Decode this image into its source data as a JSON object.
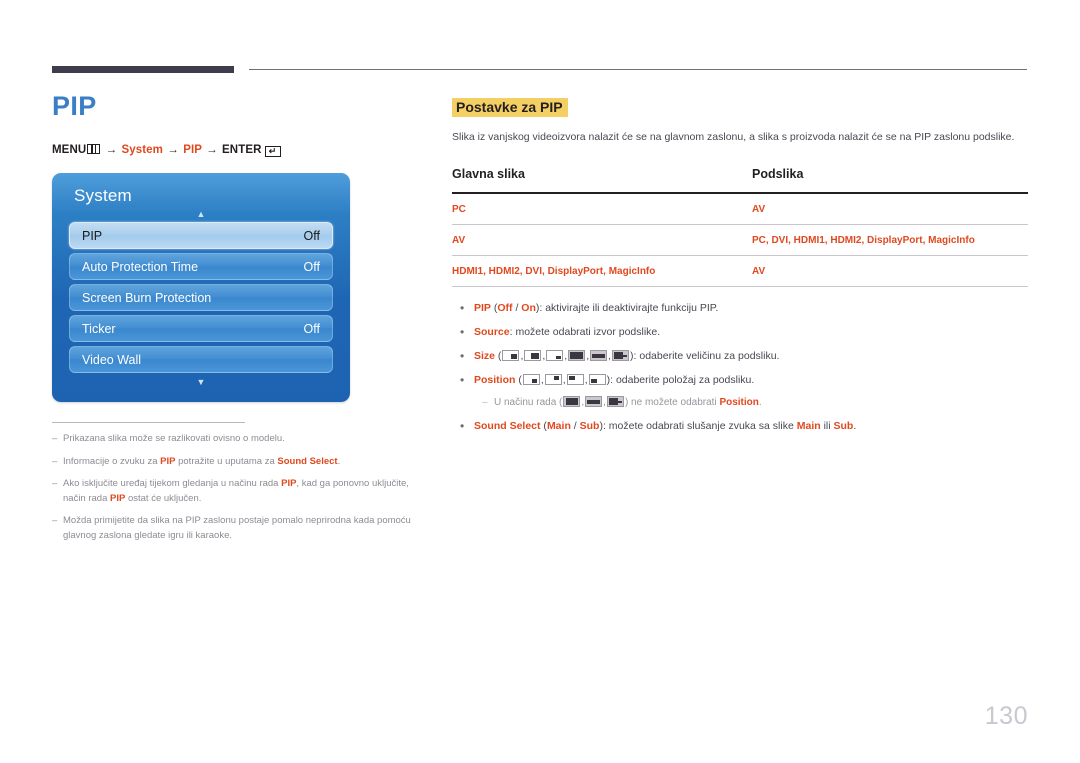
{
  "page": {
    "number": "130"
  },
  "left": {
    "title": "PIP",
    "menu_path": {
      "prefix": "MENU",
      "menu_icon": "menu-grid-icon",
      "arrow": "→",
      "step1": "System",
      "step2": "PIP",
      "enter_label": "ENTER",
      "enter_icon": "enter-key-icon",
      "enter_glyph": "↵"
    },
    "osd": {
      "title": "System",
      "scroll_up_icon": "▲",
      "scroll_down_icon": "▼",
      "rows": [
        {
          "label": "PIP",
          "value": "Off",
          "selected": true
        },
        {
          "label": "Auto Protection Time",
          "value": "Off",
          "selected": false
        },
        {
          "label": "Screen Burn Protection",
          "value": "",
          "selected": false
        },
        {
          "label": "Ticker",
          "value": "Off",
          "selected": false
        },
        {
          "label": "Video Wall",
          "value": "",
          "selected": false
        }
      ]
    },
    "footnotes": [
      {
        "dash": "–",
        "parts": [
          {
            "t": "Prikazana slika može se razlikovati ovisno o modelu.",
            "b": false
          }
        ]
      },
      {
        "dash": "–",
        "parts": [
          {
            "t": "Informacije o zvuku za ",
            "b": false
          },
          {
            "t": "PIP",
            "b": true
          },
          {
            "t": " potražite u uputama za ",
            "b": false
          },
          {
            "t": "Sound Select",
            "b": true
          },
          {
            "t": ".",
            "b": false
          }
        ]
      },
      {
        "dash": "–",
        "parts": [
          {
            "t": "Ako isključite uređaj tijekom gledanja u načinu rada ",
            "b": false
          },
          {
            "t": "PIP",
            "b": true
          },
          {
            "t": ", kad ga ponovno uključite, način rada ",
            "b": false
          },
          {
            "t": "PIP",
            "b": true
          },
          {
            "t": " ostat će uključen.",
            "b": false
          }
        ]
      },
      {
        "dash": "–",
        "parts": [
          {
            "t": "Možda primijetite da slika na PIP zaslonu postaje pomalo neprirodna kada pomoću glavnog zaslona gledate igru ili karaoke.",
            "b": false
          }
        ]
      }
    ]
  },
  "right": {
    "section_title": "Postavke za PIP",
    "intro": "Slika iz vanjskog videoizvora nalazit će se na glavnom zaslonu, a slika s proizvoda nalazit će se na PIP zaslonu podslike.",
    "table": {
      "headers": [
        "Glavna slika",
        "Podslika"
      ],
      "rows": [
        [
          "PC",
          "AV"
        ],
        [
          "AV",
          "PC, DVI, HDMI1, HDMI2, DisplayPort, MagicInfo"
        ],
        [
          "HDMI1, HDMI2, DVI, DisplayPort, MagicInfo",
          "AV"
        ]
      ]
    },
    "bullets": [
      {
        "dot": "•",
        "parts": [
          {
            "t": "PIP",
            "b": true
          },
          {
            "t": " (",
            "b": false
          },
          {
            "t": "Off",
            "b": true
          },
          {
            "t": " / ",
            "b": false
          },
          {
            "t": "On",
            "b": true
          },
          {
            "t": "): aktivirajte ili deaktivirajte funkciju PIP.",
            "b": false
          }
        ]
      },
      {
        "dot": "•",
        "parts": [
          {
            "t": "Source",
            "b": true
          },
          {
            "t": ": možete odabrati izvor podslike.",
            "b": false
          }
        ]
      },
      {
        "dot": "•",
        "label": "Size",
        "open": " (",
        "icons": [
          "pip-size-small",
          "pip-size-medium",
          "pip-size-large",
          "pip-size-double1",
          "pip-size-double2",
          "pip-size-split"
        ],
        "close": "): odaberite veličinu za podsliku."
      },
      {
        "dot": "•",
        "label": "Position",
        "open": " (",
        "icons": [
          "pip-position-bottom-right",
          "pip-position-top-right",
          "pip-position-top-left",
          "pip-position-bottom-left"
        ],
        "close": "): odaberite položaj za podsliku."
      }
    ],
    "subnote": {
      "dash": "–",
      "pre": "U načinu rada (",
      "icons": [
        "pip-size-double1",
        "pip-size-double2",
        "pip-size-split"
      ],
      "mid": ") ne možete odabrati ",
      "bold": "Position",
      "post": "."
    },
    "sound_bullet": {
      "dot": "•",
      "parts": [
        {
          "t": "Sound Select",
          "b": true
        },
        {
          "t": " (",
          "b": false
        },
        {
          "t": "Main",
          "b": true
        },
        {
          "t": " / ",
          "b": false
        },
        {
          "t": "Sub",
          "b": true
        },
        {
          "t": "): možete odabrati slušanje zvuka sa slike ",
          "b": false
        },
        {
          "t": "Main",
          "b": true
        },
        {
          "t": " ili ",
          "b": false
        },
        {
          "t": "Sub",
          "b": true
        },
        {
          "t": ".",
          "b": false
        }
      ]
    }
  },
  "colors": {
    "accent_orange": "#e0491f",
    "title_blue": "#3a7ec4",
    "highlight_yellow": "#f4cf63",
    "osd_blue": "#1e66b4",
    "page_number_gray": "#c9c7cf"
  }
}
